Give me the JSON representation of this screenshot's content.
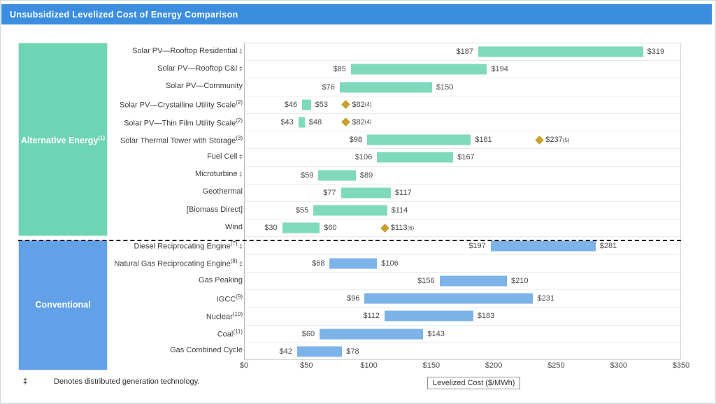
{
  "window": {
    "title": "Unsubsidized Levelized Cost of Energy Comparison",
    "title_bar_color": "#3a8ddf"
  },
  "categories": {
    "alternative": {
      "label": "Alternative Energy",
      "superscript": "(1)",
      "color": "#6ed5b4"
    },
    "conventional": {
      "label": "Conventional",
      "superscript": "",
      "color": "#62a0e8"
    }
  },
  "axis_title": "Levelized Cost ($/MWh)",
  "footnote": {
    "marker": "‡",
    "text": "Denotes distributed generation technology."
  },
  "chart_data": {
    "type": "bar",
    "title": "Unsubsidized Levelized Cost of Energy Comparison",
    "subtitle": "",
    "xlabel": "Levelized Cost ($/MWh)",
    "ylabel": "",
    "xlim": [
      0,
      350
    ],
    "xticks": [
      0,
      50,
      100,
      150,
      200,
      250,
      300,
      350
    ],
    "xtick_labels": [
      "$0",
      "$50",
      "$100",
      "$150",
      "$200",
      "$250",
      "$300",
      "$350"
    ],
    "grid": true,
    "legend": "none",
    "orientation": "horizontal-range",
    "groups": [
      {
        "name": "Alternative Energy",
        "superscript": "(1)",
        "color": "#7fd9bb",
        "rows": [
          {
            "label": "Solar PV—Rooftop Residential",
            "superscript": "",
            "dagger": "‡",
            "low": 187,
            "high": 319,
            "low_label": "$187",
            "high_label": "$319"
          },
          {
            "label": "Solar PV—Rooftop C&I",
            "superscript": "",
            "dagger": "‡",
            "low": 85,
            "high": 194,
            "low_label": "$85",
            "high_label": "$194"
          },
          {
            "label": "Solar PV—Community",
            "superscript": "",
            "dagger": "",
            "low": 76,
            "high": 150,
            "low_label": "$76",
            "high_label": "$150"
          },
          {
            "label": "Solar PV—Crystalline Utility Scale",
            "superscript": "(2)",
            "dagger": "",
            "low": 46,
            "high": 53,
            "low_label": "$46",
            "high_label": "$53",
            "marker": {
              "value": 82,
              "label": "$82",
              "superscript": "(4)",
              "color": "#c8a02e"
            }
          },
          {
            "label": "Solar PV—Thin Film Utility Scale",
            "superscript": "(2)",
            "dagger": "",
            "low": 43,
            "high": 48,
            "low_label": "$43",
            "high_label": "$48",
            "marker": {
              "value": 82,
              "label": "$82",
              "superscript": "(4)",
              "color": "#c8a02e"
            }
          },
          {
            "label": "Solar Thermal Tower with Storage",
            "superscript": "(3)",
            "dagger": "",
            "low": 98,
            "high": 181,
            "low_label": "$98",
            "high_label": "$181",
            "marker": {
              "value": 237,
              "label": "$237",
              "superscript": "(5)",
              "color": "#c8a02e"
            }
          },
          {
            "label": "Fuel Cell",
            "superscript": "",
            "dagger": "‡",
            "low": 106,
            "high": 167,
            "low_label": "$106",
            "high_label": "$167"
          },
          {
            "label": "Microturbine",
            "superscript": "",
            "dagger": "‡",
            "low": 59,
            "high": 89,
            "low_label": "$59",
            "high_label": "$89"
          },
          {
            "label": "Geothermal",
            "superscript": "",
            "dagger": "",
            "low": 77,
            "high": 117,
            "low_label": "$77",
            "high_label": "$117"
          },
          {
            "label": "[Biomass Direct]",
            "superscript": "",
            "dagger": "",
            "low": 55,
            "high": 114,
            "low_label": "$55",
            "high_label": "$114"
          },
          {
            "label": "Wind",
            "superscript": "",
            "dagger": "",
            "low": 30,
            "high": 60,
            "low_label": "$30",
            "high_label": "$60",
            "marker": {
              "value": 113,
              "label": "$113",
              "superscript": "(6)",
              "color": "#c8a02e"
            }
          }
        ]
      },
      {
        "name": "Conventional",
        "superscript": "",
        "color": "#7cb3e8",
        "rows": [
          {
            "label": "Diesel Reciprocating Engine",
            "superscript": "(7)",
            "dagger": "‡",
            "low": 197,
            "high": 281,
            "low_label": "$197",
            "high_label": "$281"
          },
          {
            "label": "Natural Gas Reciprocating Engine",
            "superscript": "(8)",
            "dagger": "‡",
            "low": 68,
            "high": 106,
            "low_label": "$68",
            "high_label": "$106"
          },
          {
            "label": "Gas Peaking",
            "superscript": "",
            "dagger": "",
            "low": 156,
            "high": 210,
            "low_label": "$156",
            "high_label": "$210"
          },
          {
            "label": "IGCC",
            "superscript": "(9)",
            "dagger": "",
            "low": 96,
            "high": 231,
            "low_label": "$96",
            "high_label": "$231"
          },
          {
            "label": "Nuclear",
            "superscript": "(10)",
            "dagger": "",
            "low": 112,
            "high": 183,
            "low_label": "$112",
            "high_label": "$183"
          },
          {
            "label": "Coal",
            "superscript": "(11)",
            "dagger": "",
            "low": 60,
            "high": 143,
            "low_label": "$60",
            "high_label": "$143"
          },
          {
            "label": "Gas Combined Cycle",
            "superscript": "",
            "dagger": "",
            "low": 42,
            "high": 78,
            "low_label": "$42",
            "high_label": "$78"
          }
        ]
      }
    ]
  }
}
